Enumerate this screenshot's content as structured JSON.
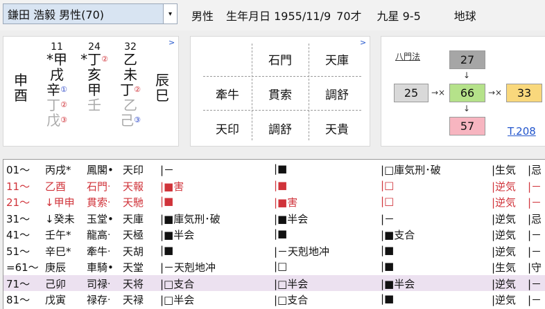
{
  "header": {
    "person": "鎌田 浩毅 男性(70)",
    "dropdown_arrow": "▾",
    "gender": "男性",
    "birth": "生年月日 1955/11/9",
    "age": "70才",
    "kyusei": "九星 9-5",
    "trunc": "地球"
  },
  "pillars": {
    "link": ">",
    "cols": [
      {
        "num": "",
        "top": "",
        "mid": "申",
        "bot": "酉",
        "hid1": "",
        "hid2": ""
      },
      {
        "num": "11",
        "top": "*甲",
        "mid": "戌",
        "bot": "辛",
        "bot_sup": "①",
        "hid1": "丁",
        "hid1_sup": "②",
        "hid2": "戊",
        "hid2_sup": "③"
      },
      {
        "num": "24",
        "top": "*丁",
        "top_sup": "②",
        "mid": "亥",
        "bot": "甲",
        "hid1": "",
        "hid2": "壬"
      },
      {
        "num": "32",
        "top": "乙",
        "mid": "未",
        "bot": "丁",
        "bot_sup": "②",
        "hid1": "乙",
        "hid2": "己",
        "hid2_sup": "③"
      },
      {
        "num": "",
        "top": "",
        "mid": "辰",
        "bot": "巳",
        "hid1": "",
        "hid2": ""
      }
    ]
  },
  "grid": {
    "link": ">",
    "cells": [
      [
        "",
        "石門",
        "天庫"
      ],
      [
        "牽牛",
        "貫索",
        "調舒"
      ],
      [
        "天印",
        "調舒",
        "天貴"
      ]
    ]
  },
  "hachimon": {
    "title": "八門法",
    "top": "27",
    "left": "25",
    "center": "66",
    "right": "33",
    "bottom": "57",
    "arrow_down": "↓",
    "arrow_right": "→×",
    "link": "T.208",
    "colors": {
      "top": "#a6a6a6",
      "left": "#d9d9d9",
      "center": "#b5e28a",
      "right": "#f9d87c",
      "bottom": "#f7b5c0"
    }
  },
  "rows": [
    {
      "age": "01〜",
      "kan": "丙戌*",
      "star1": "鳳閣•",
      "star2": "天印",
      "c1": "|－",
      "c2": "|■",
      "c3": "|□庫気刑･破",
      "c4": "|生気",
      "c5": "|忌"
    },
    {
      "age": "11〜",
      "kan": "乙酉",
      "star1": "石門ᐧ",
      "star2": "天報",
      "c1": "|■害",
      "c2": "|■",
      "c3": "|□",
      "c4": "|逆気",
      "c5": "|－"
    },
    {
      "age": "21〜",
      "kan": "↓甲申",
      "star1": "貫索ᐧ",
      "star2": "天馳",
      "c1": "|■",
      "c2": "|■害",
      "c3": "|□",
      "c4": "|逆気",
      "c5": "|－"
    },
    {
      "age": "31〜",
      "kan": "↓癸未",
      "star1": "玉堂•",
      "star2": "天庫",
      "c1": "|■庫気刑･破",
      "c2": "|■半会",
      "c3": "|－",
      "c4": "|逆気",
      "c5": "|忌"
    },
    {
      "age": "41〜",
      "kan": "壬午*",
      "star1": "龍高ᐧ",
      "star2": "天極",
      "c1": "|■半会",
      "c2": "|■",
      "c3": "|■支合",
      "c4": "|逆気",
      "c5": "|－"
    },
    {
      "age": "51〜",
      "kan": "辛巳*",
      "star1": "牽牛ᐧ",
      "star2": "天胡",
      "c1": "|■",
      "c2": "|－天剋地冲",
      "c3": "|■",
      "c4": "|逆気",
      "c5": "|－"
    },
    {
      "age": "=61〜",
      "kan": "庚辰",
      "star1": "車騎•",
      "star2": "天堂",
      "c1": "|－天剋地冲",
      "c2": "|□",
      "c3": "|■",
      "c4": "|生気",
      "c5": "|守"
    },
    {
      "age": "71〜",
      "kan": "己卯",
      "star1": "司禄ᐧ",
      "star2": "天将",
      "c1": "|□支合",
      "c2": "|□半会",
      "c3": "|■半会",
      "c4": "|逆気",
      "c5": "|－"
    },
    {
      "age": "81〜",
      "kan": "戊寅",
      "star1": "禄存ᐧ",
      "star2": "天禄",
      "c1": "|□半会",
      "c2": "|□支合",
      "c3": "|■",
      "c4": "|逆気",
      "c5": "|－"
    }
  ],
  "row_styles": {
    "red": [
      1,
      2
    ],
    "highlight": [
      7
    ]
  }
}
